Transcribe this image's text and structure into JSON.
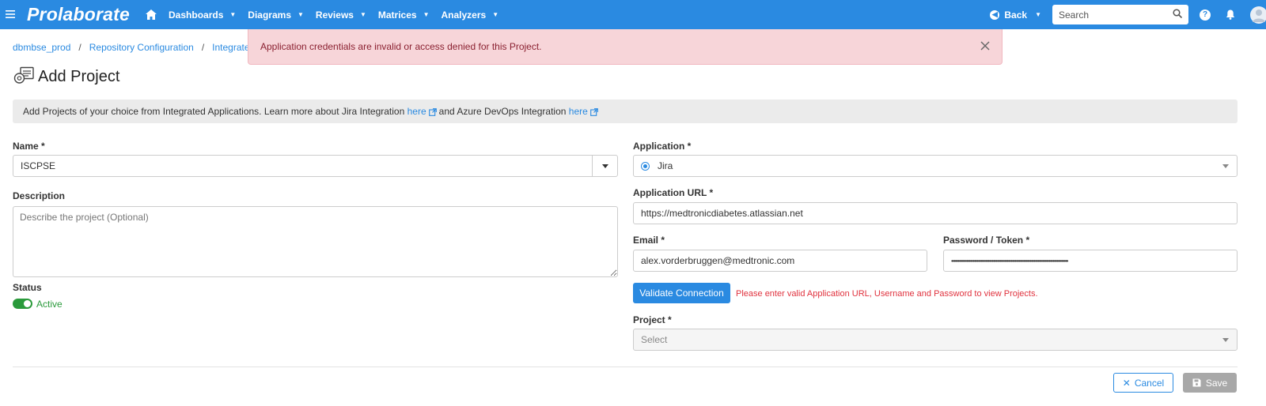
{
  "header": {
    "logo": "Prolaborate",
    "nav": [
      {
        "label": "Dashboards"
      },
      {
        "label": "Diagrams"
      },
      {
        "label": "Reviews"
      },
      {
        "label": "Matrices"
      },
      {
        "label": "Analyzers"
      }
    ],
    "back_label": "Back",
    "search_placeholder": "Search",
    "accent": "#2a8ae1"
  },
  "breadcrumb": {
    "items": [
      "dbmbse_prod",
      "Repository Configuration",
      "Integrated A"
    ],
    "separator": "/"
  },
  "alert": {
    "message": "Application credentials are invalid or access denied for this Project.",
    "background": "#f7d5d9"
  },
  "page": {
    "title": "Add Project"
  },
  "info": {
    "text_before": "Add Projects of your choice from Integrated Applications. Learn more about Jira Integration",
    "link1": "here",
    "text_middle": "and Azure DevOps Integration",
    "link2": "here"
  },
  "form": {
    "name_label": "Name *",
    "name_value": "ISCPSE",
    "description_label": "Description",
    "description_placeholder": "Describe the project (Optional)",
    "status_label": "Status",
    "status_value": "Active",
    "application_label": "Application *",
    "application_value": "Jira",
    "app_url_label": "Application URL *",
    "app_url_value": "https://medtronicdiabetes.atlassian.net",
    "email_label": "Email *",
    "email_value": "alex.vorderbruggen@medtronic.com",
    "password_label": "Password / Token *",
    "password_value": "••••••••••••••••••••••••••••••••••••••••••••••••••••••••••••••••••••••••••••••••••••••••••••",
    "validate_label": "Validate Connection",
    "validate_error": "Please enter valid Application URL, Username and Password to view Projects.",
    "project_label": "Project *",
    "project_placeholder": "Select"
  },
  "footer": {
    "cancel_label": "Cancel",
    "save_label": "Save"
  }
}
